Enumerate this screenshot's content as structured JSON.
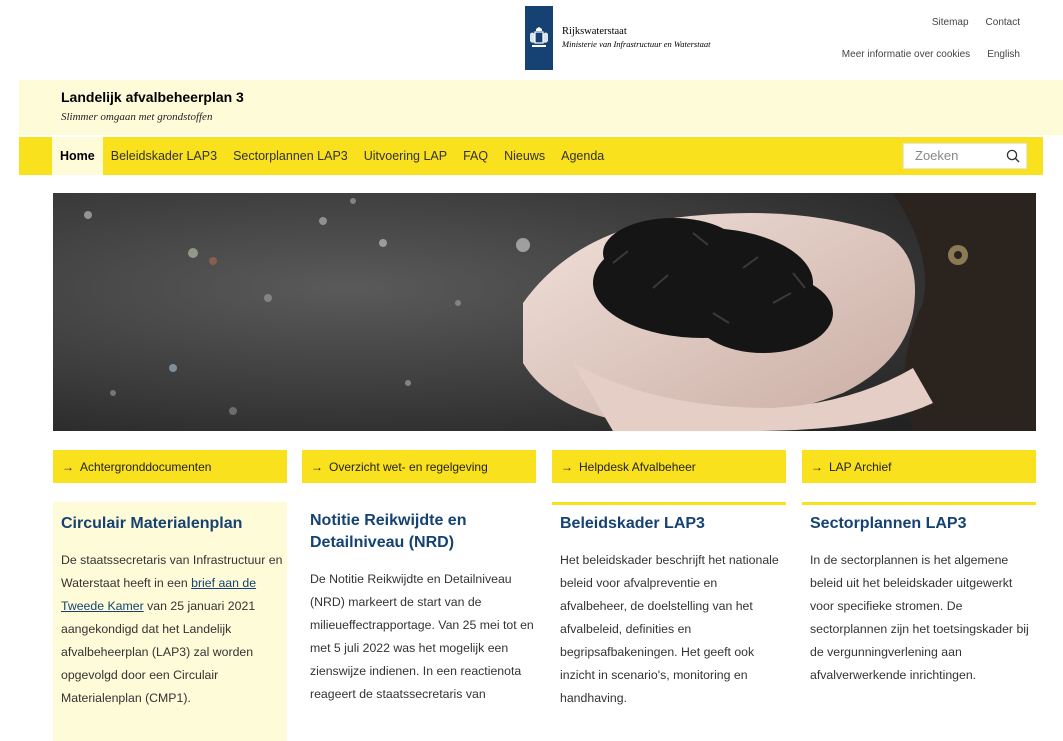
{
  "logo": {
    "line1": "Rijkswaterstaat",
    "line2": "Ministerie van Infrastructuur en Waterstaat"
  },
  "toplinks": {
    "sitemap": "Sitemap",
    "contact": "Contact",
    "cookies": "Meer informatie over cookies",
    "english": "English"
  },
  "site": {
    "title": "Landelijk afvalbeheerplan 3",
    "subtitle": "Slimmer omgaan met grondstoffen"
  },
  "nav": {
    "items": [
      "Home",
      "Beleidskader LAP3",
      "Sectorplannen LAP3",
      "Uitvoering LAP",
      "FAQ",
      "Nieuws",
      "Agenda"
    ]
  },
  "search": {
    "placeholder": "Zoeken"
  },
  "links": [
    {
      "label": "Achtergronddocumenten"
    },
    {
      "label": "Overzicht wet- en regelgeving"
    },
    {
      "label": "Helpdesk Afvalbeheer"
    },
    {
      "label": "LAP Archief"
    }
  ],
  "cards": [
    {
      "title": "Circulair Materialenplan",
      "text_before": "De staatssecretaris van Infrastructuur en Waterstaat heeft in een ",
      "link": "brief aan de Tweede Kamer",
      "text_after": " van 25 januari 2021 aangekondigd dat het Landelijk afvalbeheerplan (LAP3) zal worden opgevolgd door een Circulair Materialenplan (CMP1)."
    },
    {
      "title": "Notitie Reikwijdte en Detailniveau (NRD)",
      "text": "De Notitie Reikwijdte en Detailniveau (NRD) markeert de start van de milieueffectrapportage. Van 25 mei tot en met 5 juli 2022 was het mogelijk een zienswijze indienen. In een reactienota reageert de staatssecretaris van"
    },
    {
      "title": "Beleidskader LAP3",
      "text": "Het beleidskader beschrijft het nationale beleid voor afvalpreventie en afvalbeheer, de doelstelling van het afvalbeleid, definities en begripsafbakeningen. Het geeft ook inzicht in scenario's, monitoring en handhaving."
    },
    {
      "title": "Sectorplannen LAP3",
      "text": "In de sectorplannen is het algemene beleid uit het beleidskader uitgewerkt voor specifieke stromen. De sectorplannen zijn het toetsingskader bij de vergunningverlening aan afvalverwerkende inrichtingen."
    }
  ],
  "colors": {
    "brand_yellow": "#f9e11e",
    "light_yellow": "#fefbd8",
    "rijks_blue": "#154273"
  },
  "icons": {
    "arrow": "arrow-right-icon",
    "search": "search-icon",
    "logo": "rijksoverheid-coat-of-arms"
  }
}
